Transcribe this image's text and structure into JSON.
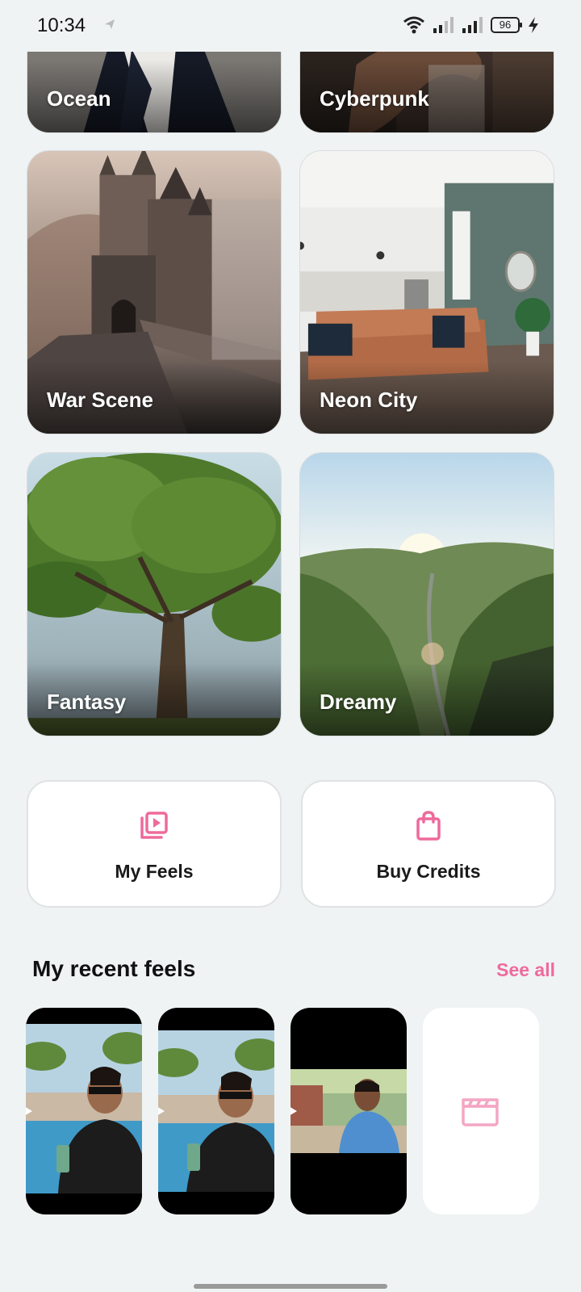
{
  "status": {
    "time": "10:34",
    "battery": "96",
    "icons": [
      "navigation-arrow-icon",
      "wifi-icon",
      "signal-icon",
      "signal-icon",
      "battery-icon",
      "charging-icon"
    ]
  },
  "styles": [
    {
      "label": "Ocean"
    },
    {
      "label": "Cyberpunk"
    },
    {
      "label": "War Scene"
    },
    {
      "label": "Neon City"
    },
    {
      "label": "Fantasy"
    },
    {
      "label": "Dreamy"
    }
  ],
  "actions": {
    "my_feels": {
      "label": "My Feels",
      "icon": "video-library-icon"
    },
    "buy_credits": {
      "label": "Buy Credits",
      "icon": "shopping-bag-icon"
    }
  },
  "recent": {
    "title": "My recent feels",
    "see_all": "See all",
    "empty_icon": "clapperboard-icon"
  },
  "colors": {
    "accent": "#ee6a9b",
    "background": "#f0f3f4"
  }
}
